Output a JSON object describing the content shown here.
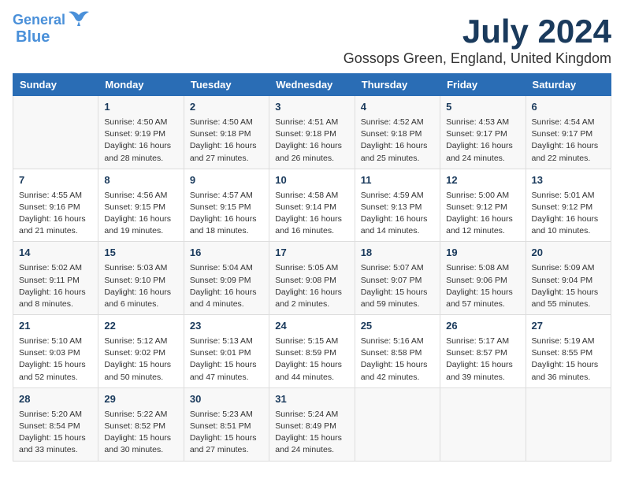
{
  "logo": {
    "line1": "General",
    "line2": "Blue"
  },
  "title": "July 2024",
  "location": "Gossops Green, England, United Kingdom",
  "days": [
    "Sunday",
    "Monday",
    "Tuesday",
    "Wednesday",
    "Thursday",
    "Friday",
    "Saturday"
  ],
  "rows": [
    [
      {
        "date": "",
        "info": ""
      },
      {
        "date": "1",
        "info": "Sunrise: 4:50 AM\nSunset: 9:19 PM\nDaylight: 16 hours\nand 28 minutes."
      },
      {
        "date": "2",
        "info": "Sunrise: 4:50 AM\nSunset: 9:18 PM\nDaylight: 16 hours\nand 27 minutes."
      },
      {
        "date": "3",
        "info": "Sunrise: 4:51 AM\nSunset: 9:18 PM\nDaylight: 16 hours\nand 26 minutes."
      },
      {
        "date": "4",
        "info": "Sunrise: 4:52 AM\nSunset: 9:18 PM\nDaylight: 16 hours\nand 25 minutes."
      },
      {
        "date": "5",
        "info": "Sunrise: 4:53 AM\nSunset: 9:17 PM\nDaylight: 16 hours\nand 24 minutes."
      },
      {
        "date": "6",
        "info": "Sunrise: 4:54 AM\nSunset: 9:17 PM\nDaylight: 16 hours\nand 22 minutes."
      }
    ],
    [
      {
        "date": "7",
        "info": "Sunrise: 4:55 AM\nSunset: 9:16 PM\nDaylight: 16 hours\nand 21 minutes."
      },
      {
        "date": "8",
        "info": "Sunrise: 4:56 AM\nSunset: 9:15 PM\nDaylight: 16 hours\nand 19 minutes."
      },
      {
        "date": "9",
        "info": "Sunrise: 4:57 AM\nSunset: 9:15 PM\nDaylight: 16 hours\nand 18 minutes."
      },
      {
        "date": "10",
        "info": "Sunrise: 4:58 AM\nSunset: 9:14 PM\nDaylight: 16 hours\nand 16 minutes."
      },
      {
        "date": "11",
        "info": "Sunrise: 4:59 AM\nSunset: 9:13 PM\nDaylight: 16 hours\nand 14 minutes."
      },
      {
        "date": "12",
        "info": "Sunrise: 5:00 AM\nSunset: 9:12 PM\nDaylight: 16 hours\nand 12 minutes."
      },
      {
        "date": "13",
        "info": "Sunrise: 5:01 AM\nSunset: 9:12 PM\nDaylight: 16 hours\nand 10 minutes."
      }
    ],
    [
      {
        "date": "14",
        "info": "Sunrise: 5:02 AM\nSunset: 9:11 PM\nDaylight: 16 hours\nand 8 minutes."
      },
      {
        "date": "15",
        "info": "Sunrise: 5:03 AM\nSunset: 9:10 PM\nDaylight: 16 hours\nand 6 minutes."
      },
      {
        "date": "16",
        "info": "Sunrise: 5:04 AM\nSunset: 9:09 PM\nDaylight: 16 hours\nand 4 minutes."
      },
      {
        "date": "17",
        "info": "Sunrise: 5:05 AM\nSunset: 9:08 PM\nDaylight: 16 hours\nand 2 minutes."
      },
      {
        "date": "18",
        "info": "Sunrise: 5:07 AM\nSunset: 9:07 PM\nDaylight: 15 hours\nand 59 minutes."
      },
      {
        "date": "19",
        "info": "Sunrise: 5:08 AM\nSunset: 9:06 PM\nDaylight: 15 hours\nand 57 minutes."
      },
      {
        "date": "20",
        "info": "Sunrise: 5:09 AM\nSunset: 9:04 PM\nDaylight: 15 hours\nand 55 minutes."
      }
    ],
    [
      {
        "date": "21",
        "info": "Sunrise: 5:10 AM\nSunset: 9:03 PM\nDaylight: 15 hours\nand 52 minutes."
      },
      {
        "date": "22",
        "info": "Sunrise: 5:12 AM\nSunset: 9:02 PM\nDaylight: 15 hours\nand 50 minutes."
      },
      {
        "date": "23",
        "info": "Sunrise: 5:13 AM\nSunset: 9:01 PM\nDaylight: 15 hours\nand 47 minutes."
      },
      {
        "date": "24",
        "info": "Sunrise: 5:15 AM\nSunset: 8:59 PM\nDaylight: 15 hours\nand 44 minutes."
      },
      {
        "date": "25",
        "info": "Sunrise: 5:16 AM\nSunset: 8:58 PM\nDaylight: 15 hours\nand 42 minutes."
      },
      {
        "date": "26",
        "info": "Sunrise: 5:17 AM\nSunset: 8:57 PM\nDaylight: 15 hours\nand 39 minutes."
      },
      {
        "date": "27",
        "info": "Sunrise: 5:19 AM\nSunset: 8:55 PM\nDaylight: 15 hours\nand 36 minutes."
      }
    ],
    [
      {
        "date": "28",
        "info": "Sunrise: 5:20 AM\nSunset: 8:54 PM\nDaylight: 15 hours\nand 33 minutes."
      },
      {
        "date": "29",
        "info": "Sunrise: 5:22 AM\nSunset: 8:52 PM\nDaylight: 15 hours\nand 30 minutes."
      },
      {
        "date": "30",
        "info": "Sunrise: 5:23 AM\nSunset: 8:51 PM\nDaylight: 15 hours\nand 27 minutes."
      },
      {
        "date": "31",
        "info": "Sunrise: 5:24 AM\nSunset: 8:49 PM\nDaylight: 15 hours\nand 24 minutes."
      },
      {
        "date": "",
        "info": ""
      },
      {
        "date": "",
        "info": ""
      },
      {
        "date": "",
        "info": ""
      }
    ]
  ]
}
